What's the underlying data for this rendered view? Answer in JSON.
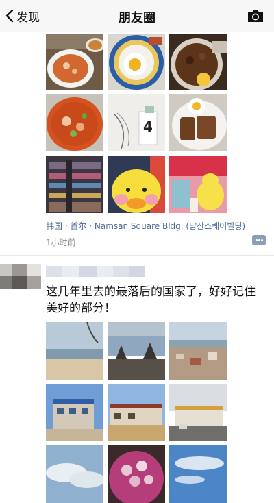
{
  "navbar": {
    "back_label": "发现",
    "title": "朋友圈",
    "camera_icon": "camera-icon"
  },
  "post1": {
    "location": "韩国 · 首尔 · Namsan Square Bldg. (남산스퀘어빌딩)",
    "time": "1小时前",
    "comment_icon": "comment-dots-icon"
  },
  "post2": {
    "text": "这几年里去的最落后的国家了，好好记住美好的部分！"
  },
  "colors": {
    "link": "#4a6b94",
    "muted": "#8c8c8c",
    "navbar_bg": "#f7f7f7"
  }
}
